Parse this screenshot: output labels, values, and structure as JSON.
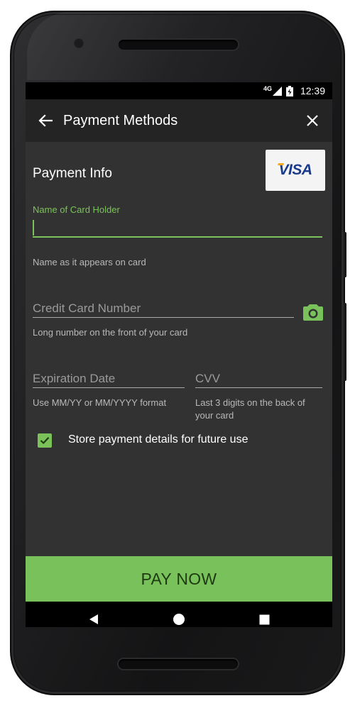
{
  "status_bar": {
    "network": "4G",
    "time": "12:39"
  },
  "app_bar": {
    "title": "Payment Methods",
    "back_icon": "arrow-left-icon",
    "close_icon": "close-icon"
  },
  "payment_info": {
    "title": "Payment Info",
    "card_brand": "VISA",
    "card_holder": {
      "label": "Name of Card Holder",
      "value": "",
      "helper": "Name as it appears on card"
    },
    "card_number": {
      "placeholder": "Credit Card Number",
      "helper": "Long number on the front of your card",
      "scan_icon": "camera-icon"
    },
    "expiration": {
      "placeholder": "Expiration Date",
      "helper": "Use MM/YY or MM/YYYY format"
    },
    "cvv": {
      "placeholder": "CVV",
      "helper": "Last 3 digits on the back of your card"
    },
    "store_details": {
      "label": "Store payment details for future use",
      "checked": true
    }
  },
  "pay_button": {
    "label": "PAY NOW"
  },
  "nav_bar": {
    "back": "triangle-back-icon",
    "home": "circle-home-icon",
    "recents": "square-recents-icon"
  },
  "colors": {
    "accent": "#79c15a",
    "screen_bg": "#323232",
    "app_bar_bg": "#242424",
    "visa_blue": "#1a3a8b"
  }
}
